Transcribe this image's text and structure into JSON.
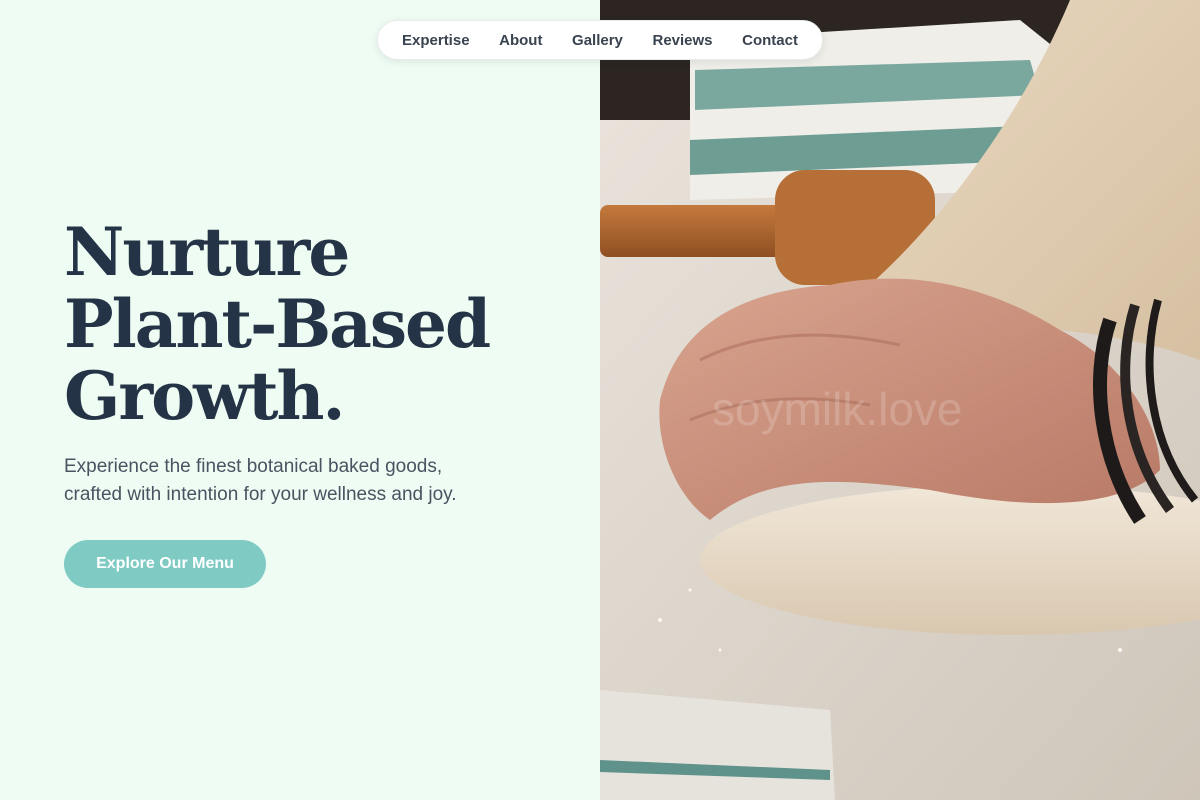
{
  "nav": {
    "items": [
      {
        "label": "Expertise"
      },
      {
        "label": "About"
      },
      {
        "label": "Gallery"
      },
      {
        "label": "Reviews"
      },
      {
        "label": "Contact"
      }
    ]
  },
  "hero": {
    "title_lines": [
      "Nurture",
      "Plant-Based",
      "Growth."
    ],
    "subtitle_lines": [
      "Experience the finest botanical baked goods,",
      "crafted with intention for your wellness and joy."
    ],
    "cta_label": "Explore Our Menu"
  },
  "image": {
    "watermark": "soymilk.love"
  },
  "colors": {
    "background": "#effcf3",
    "heading": "#243446",
    "body_text": "#4a5361",
    "accent": "#7fcbc4",
    "nav_bg": "#ffffff"
  }
}
